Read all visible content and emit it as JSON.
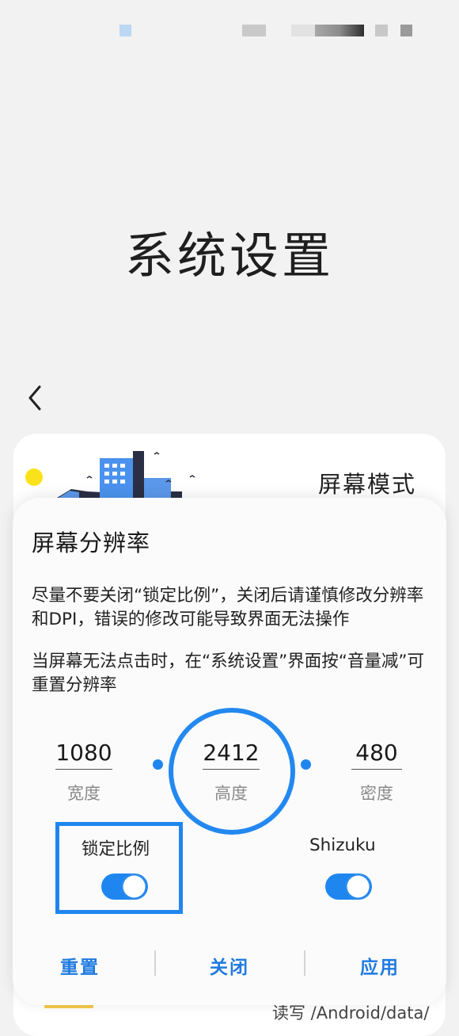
{
  "colors": {
    "accent": "#1f86ef",
    "background": "#f2f2f2",
    "card": "#ffffff"
  },
  "page": {
    "title": "系统设置"
  },
  "background_card": {
    "title": "屏幕模式",
    "hint": "读写 /Android/data/"
  },
  "dialog": {
    "title": "屏幕分辨率",
    "description1": "尽量不要关闭“锁定比例”，关闭后请谨慎修改分辨率和DPI，错误的修改可能导致界面无法操作",
    "description2": "当屏幕无法点击时，在“系统设置”界面按“音量减”可重置分辨率",
    "width": {
      "value": "1080",
      "label": "宽度"
    },
    "height": {
      "value": "2412",
      "label": "高度"
    },
    "density": {
      "value": "480",
      "label": "密度"
    },
    "lock_ratio": {
      "label": "锁定比例",
      "on": true
    },
    "shizuku": {
      "label": "Shizuku",
      "on": true
    },
    "buttons": {
      "reset": "重置",
      "close": "关闭",
      "apply": "应用"
    }
  },
  "icons": {
    "back": "chevron-left-icon"
  }
}
